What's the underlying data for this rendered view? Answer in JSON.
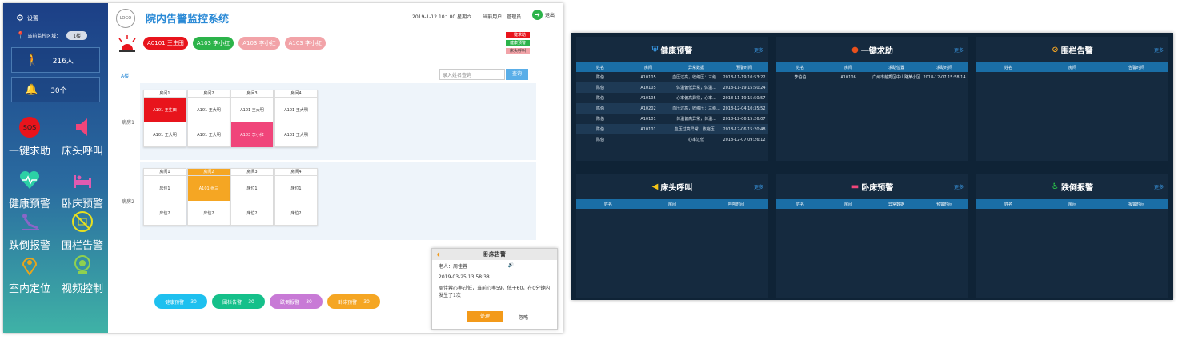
{
  "sidebar": {
    "settings_label": "设置",
    "location_label": "当前监控区域：",
    "location_value": "1楼",
    "people_count": "216人",
    "alert_count": "30个",
    "items": [
      {
        "label": "一键求助",
        "icon": "sos-icon"
      },
      {
        "label": "床头呼叫",
        "icon": "speaker-icon"
      },
      {
        "label": "健康预警",
        "icon": "heart-icon"
      },
      {
        "label": "卧床预警",
        "icon": "bed-icon"
      },
      {
        "label": "跌倒报警",
        "icon": "fall-icon"
      },
      {
        "label": "围栏告警",
        "icon": "fence-icon"
      },
      {
        "label": "室内定位",
        "icon": "location-icon"
      },
      {
        "label": "视频控制",
        "icon": "camera-icon"
      }
    ]
  },
  "header": {
    "logo_text": "LOGO",
    "title": "院内告警监控系统",
    "datetime": "2019-1-12 10：00 星期六",
    "user": "当前用户：管理员",
    "exit_label": "退出"
  },
  "alarm_chips": [
    {
      "text": "A0101 王生田",
      "color": "#e8141c"
    },
    {
      "text": "A103 李小红",
      "color": "#2cb34a"
    },
    {
      "text": "A103 李小红",
      "color": "#f2a3a8"
    },
    {
      "text": "A103 李小红",
      "color": "#f2a3a8"
    }
  ],
  "legend": [
    {
      "label": "一键求助",
      "color": "#e8141c"
    },
    {
      "label": "健康预警",
      "color": "#2cb34a"
    },
    {
      "label": "床头呼叫",
      "color": "#f2a3a8"
    }
  ],
  "filter": {
    "floor_tab": "A楼",
    "search_placeholder": "录入姓名查询",
    "search_button": "查询"
  },
  "wards": [
    {
      "label": "病房1",
      "rooms": [
        {
          "name": "房间1",
          "beds": [
            {
              "text": "A101 王生田",
              "color": "#e8141c"
            },
            {
              "text": "A101 王大明",
              "color": ""
            }
          ]
        },
        {
          "name": "房间2",
          "beds": [
            {
              "text": "A101 王大明",
              "color": ""
            },
            {
              "text": "A101 王大明",
              "color": ""
            }
          ]
        },
        {
          "name": "房间3",
          "beds": [
            {
              "text": "A101 王大明",
              "color": ""
            },
            {
              "text": "A103 李小红",
              "color": "#f0457a"
            }
          ]
        },
        {
          "name": "房间4",
          "beds": [
            {
              "text": "A101 王大明",
              "color": ""
            },
            {
              "text": "A101 王大明",
              "color": ""
            }
          ]
        }
      ]
    },
    {
      "label": "病房2",
      "rooms": [
        {
          "name": "房间1",
          "beds": [
            {
              "text": "床位1",
              "color": ""
            },
            {
              "text": "床位2",
              "color": ""
            }
          ]
        },
        {
          "name": "房间2",
          "beds": [
            {
              "text": "A101 张三",
              "color": "#f5a623"
            },
            {
              "text": "床位2",
              "color": ""
            }
          ]
        },
        {
          "name": "房间3",
          "beds": [
            {
              "text": "床位1",
              "color": ""
            },
            {
              "text": "床位2",
              "color": ""
            }
          ]
        },
        {
          "name": "房间4",
          "beds": [
            {
              "text": "床位1",
              "color": ""
            },
            {
              "text": "床位2",
              "color": ""
            }
          ]
        }
      ]
    }
  ],
  "bottom_buttons": [
    {
      "label": "健康预警",
      "count": "30",
      "color": "#1ec0ef"
    },
    {
      "label": "围栏告警",
      "count": "30",
      "color": "#15c08a"
    },
    {
      "label": "跌倒报警",
      "count": "30",
      "color": "#c87ad6"
    },
    {
      "label": "卧床预警",
      "count": "30",
      "color": "#f5a623"
    }
  ],
  "popup": {
    "title": "卧床告警",
    "person": "老人：周佳蓉",
    "time": "2019-03-25 13:58:38",
    "message": "周佳蓉心率过低，当前心率59，低于60，在0分钟内发生了1次",
    "handle_label": "处理",
    "ignore_label": "忽略"
  },
  "dashboard": {
    "more_label": "更多",
    "panels": [
      {
        "title": "健康预警",
        "icon": "shield-icon",
        "headers": [
          "姓名",
          "房间",
          "异常数据",
          "预警时间"
        ],
        "rows": [
          [
            "陈伯",
            "A10105",
            "血压过高，收缩压：三级...",
            "2018-11-19 10:53:22"
          ],
          [
            "陈伯",
            "A10105",
            "体温偏低异常，体温...",
            "2018-11-19 15:50:24"
          ],
          [
            "陈伯",
            "A10105",
            "心率偏高异常，心率...",
            "2018-11-19 15:50:57"
          ],
          [
            "陈伯",
            "A10202",
            "血压过高，收缩压：三级...",
            "2018-12-04 10:35:52"
          ],
          [
            "陈伯",
            "A10101",
            "体温偏高异常，体温...",
            "2018-12-06 15:26:07"
          ],
          [
            "陈伯",
            "A10101",
            "血压过高异常，收缩压...",
            "2018-12-06 15:20:48"
          ],
          [
            "陈伯",
            "",
            "心率过低",
            "2018-12-07 09:26:12"
          ]
        ]
      },
      {
        "title": "一键求助",
        "icon": "sos-icon",
        "headers": [
          "姓名",
          "房间",
          "求助位置",
          "求助时间"
        ],
        "rows": [
          [
            "李伯伯",
            "A10106",
            "广州市越秀区中山路某小区...",
            "2018-12-07 15:58:14"
          ]
        ]
      },
      {
        "title": "围栏告警",
        "icon": "fence-icon",
        "headers": [
          "姓名",
          "房间",
          "告警时间"
        ],
        "rows": []
      },
      {
        "title": "床头呼叫",
        "icon": "speaker-icon",
        "headers": [
          "姓名",
          "房间",
          "呼叫时间"
        ],
        "rows": []
      },
      {
        "title": "卧床预警",
        "icon": "bed-icon",
        "headers": [
          "姓名",
          "房间",
          "异常数据",
          "预警时间"
        ],
        "rows": []
      },
      {
        "title": "跌倒报警",
        "icon": "fall-icon",
        "headers": [
          "姓名",
          "房间",
          "报警时间"
        ],
        "rows": []
      }
    ]
  }
}
